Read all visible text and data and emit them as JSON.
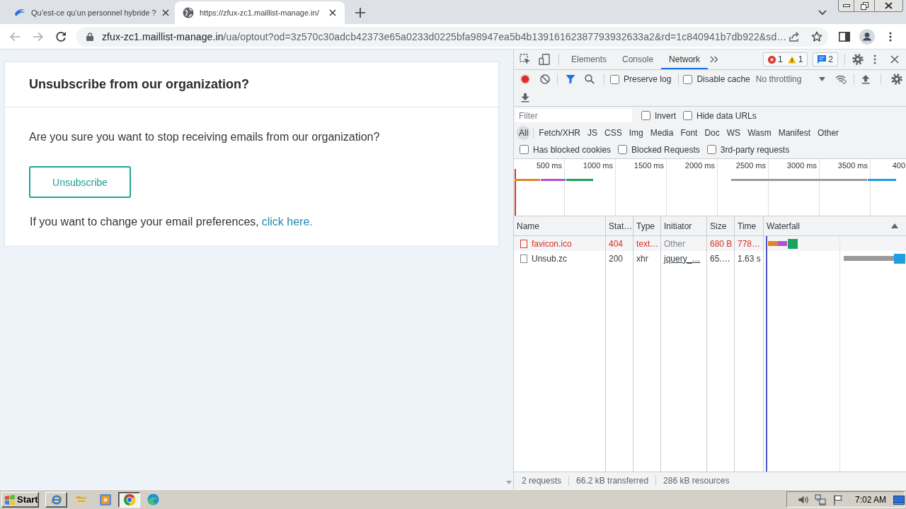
{
  "browser_tabs": [
    {
      "kind": "logo",
      "title": "Qu’est-ce qu’un personnel hybride ?",
      "selected": false
    },
    {
      "kind": "globe",
      "title": "https://zfux-zc1.maillist-manage.in/",
      "selected": true
    }
  ],
  "address_bar": {
    "host": "zfux-zc1.maillist-manage.in",
    "path": "/ua/optout?od=3z570c30adcb42373e65a0233d0225bfa98947ea5b4b13916162387793932633a2&rd=1c840941b7db922&sd…"
  },
  "page": {
    "heading": "Unsubscribe from our organization?",
    "question": "Are you sure you want to stop receiving emails from our organization?",
    "unsubscribe_button": "Unsubscribe",
    "preferences_text": "If you want to change your email preferences,",
    "preferences_link": "click here."
  },
  "devtools": {
    "tabs": [
      {
        "label": "Elements",
        "selected": false
      },
      {
        "label": "Console",
        "selected": false
      },
      {
        "label": "Network",
        "selected": true
      }
    ],
    "issues": {
      "errors": "1",
      "warnings": "1",
      "messages": "2"
    },
    "recording": true,
    "toolbar_options": [
      {
        "label": "Preserve log",
        "checked": false
      },
      {
        "label": "Disable cache",
        "checked": false
      }
    ],
    "throttling": "No throttling",
    "filter": {
      "placeholder": "Filter"
    },
    "filter_options": [
      {
        "label": "Invert",
        "checked": false
      },
      {
        "label": "Hide data URLs",
        "checked": false
      }
    ],
    "type_filters": [
      {
        "label": "All",
        "selected": true
      },
      {
        "label": "Fetch/XHR",
        "selected": false
      },
      {
        "label": "JS",
        "selected": false
      },
      {
        "label": "CSS",
        "selected": false
      },
      {
        "label": "Img",
        "selected": false
      },
      {
        "label": "Media",
        "selected": false
      },
      {
        "label": "Font",
        "selected": false
      },
      {
        "label": "Doc",
        "selected": false
      },
      {
        "label": "WS",
        "selected": false
      },
      {
        "label": "Wasm",
        "selected": false
      },
      {
        "label": "Manifest",
        "selected": false
      },
      {
        "label": "Other",
        "selected": false
      }
    ],
    "request_filters": [
      {
        "label": "Has blocked cookies",
        "checked": false
      },
      {
        "label": "Blocked Requests",
        "checked": false
      },
      {
        "label": "3rd-party requests",
        "checked": false
      }
    ],
    "timeline_ticks": [
      "500 ms",
      "1000 ms",
      "1500 ms",
      "2000 ms",
      "2500 ms",
      "3000 ms",
      "3500 ms",
      "400"
    ],
    "columns": [
      "Name",
      "Stat…",
      "Type",
      "Initiator",
      "Size",
      "Time",
      "Waterfall"
    ],
    "rows": [
      {
        "name": "favicon.ico",
        "status": "404",
        "type": "text…",
        "initiator": "Other",
        "initiator_link": false,
        "size": "680 B",
        "time": "778…",
        "error": true
      },
      {
        "name": "Unsub.zc",
        "status": "200",
        "type": "xhr",
        "initiator": "jquery_…",
        "initiator_link": true,
        "size": "65.…",
        "time": "1.63 s",
        "error": false
      }
    ],
    "status_bar": [
      "2 requests",
      "66.2 kB transferred",
      "286 kB resources"
    ]
  },
  "taskbar": {
    "start": "Start",
    "clock": "7:02 AM"
  }
}
